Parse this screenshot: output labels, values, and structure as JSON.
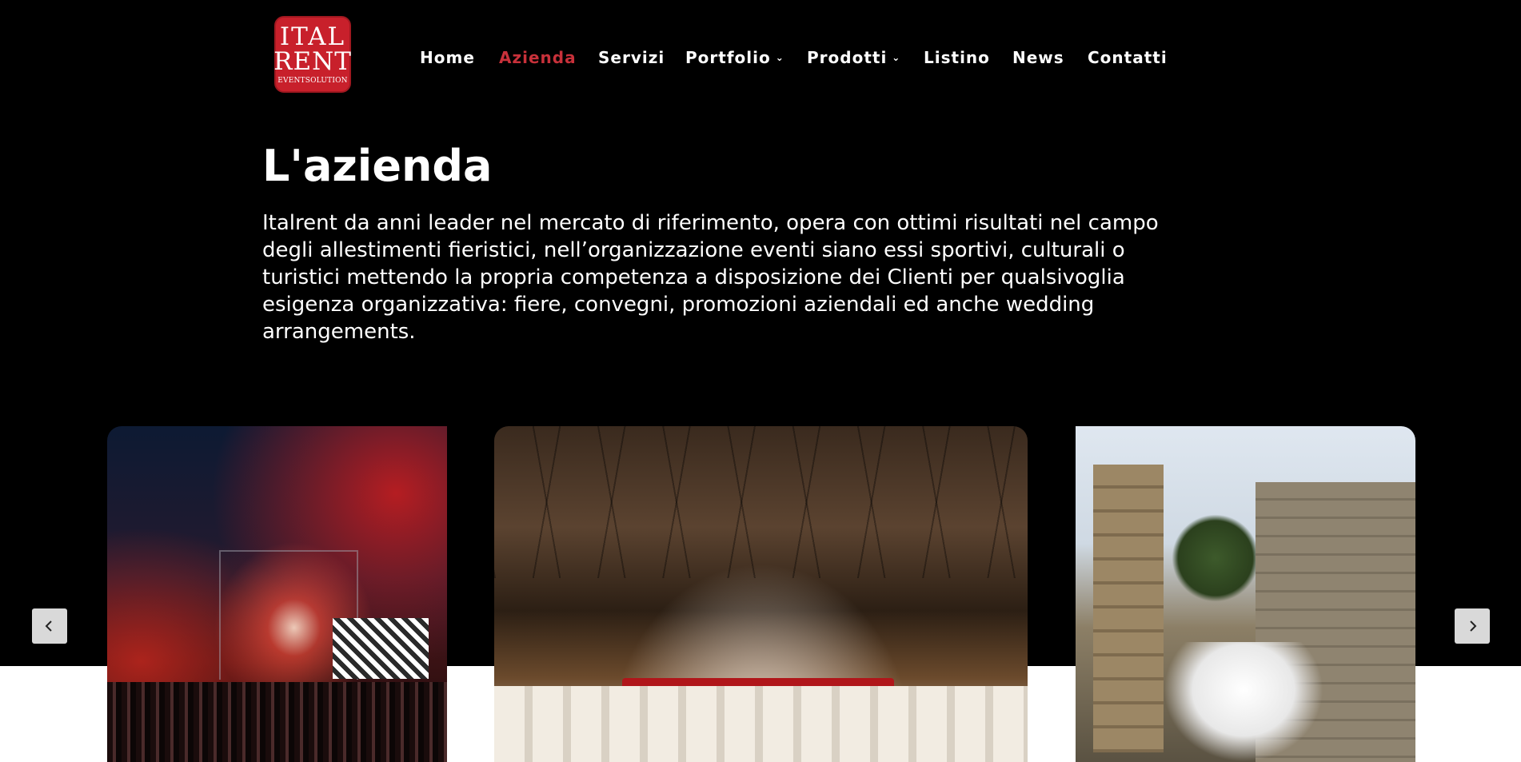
{
  "logo": {
    "line1": "ITAL",
    "line2": "RENT",
    "line3": "EVENTSOLUTION"
  },
  "nav": {
    "items": [
      {
        "label": "Home"
      },
      {
        "label": "Azienda",
        "active": true
      },
      {
        "label": "Servizi"
      },
      {
        "label": "Portfolio",
        "dropdown": true
      },
      {
        "label": "Prodotti",
        "dropdown": true
      },
      {
        "label": "Listino"
      },
      {
        "label": "News"
      },
      {
        "label": "Contatti"
      }
    ]
  },
  "page": {
    "title": "L'azienda",
    "intro": "Italrent da anni leader nel mercato di riferimento, opera con ottimi risultati nel campo degli allestimenti fieristici, nell’organizzazione eventi siano essi sportivi, culturali o turistici mettendo la propria competenza a disposizione dei Clienti per qualsivoglia esigenza organizzativa: fiere, convegni, promozioni aziendali ed anche wedding arrangements."
  },
  "carousel": {
    "prev_icon": "chevron-left-icon",
    "next_icon": "chevron-right-icon"
  },
  "colors": {
    "background": "#000000",
    "accent": "#c8313a",
    "logo": "#c8202b"
  }
}
